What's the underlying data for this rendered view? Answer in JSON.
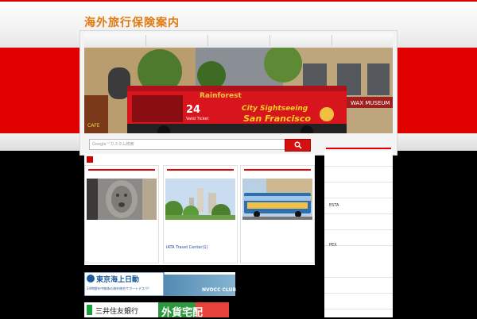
{
  "site": {
    "title": "海外旅行保険案内"
  },
  "hero": {
    "sign_rainforest": "Rainforest",
    "sign_bus": "City Sightseeing",
    "sign_city": "San Francisco",
    "sign_ticket_num": "24",
    "sign_ticket_text": "Valid Ticket",
    "sign_museum": "WAX MUSEUM",
    "sign_cafe": "CAFE"
  },
  "search": {
    "placeholder": "Google™カスタム検索"
  },
  "cards": [
    {
      "caption": ""
    },
    {
      "caption": "IATA Travel Center(1)"
    },
    {
      "caption": ""
    }
  ],
  "sidebar": {
    "items": [
      "",
      "",
      "",
      "ESTA",
      "",
      "",
      "",
      "PEX",
      "",
      ""
    ]
  },
  "banners": {
    "tokio_name": "東京海上日動",
    "tokio_sub": "24時間年中無休の海外総合サポートデスク!",
    "nvocc_title": "NVOCC CLUB",
    "smbc_name": "三井住友銀行",
    "smbc_tag": "外貨宅配"
  },
  "colors": {
    "brand_red": "#e00000",
    "title_orange": "#e07a10",
    "link_blue": "#1a4fa0"
  }
}
